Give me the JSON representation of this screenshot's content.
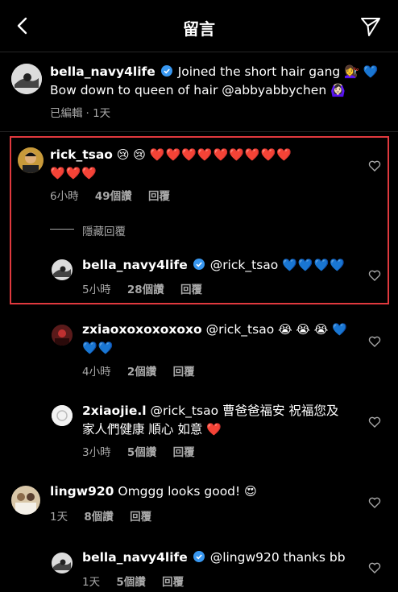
{
  "header": {
    "title": "留言"
  },
  "caption": {
    "username": "bella_navy4life",
    "text_line1": "Joined the short hair gang",
    "line1_emoji": "💇‍♀️",
    "line1_heart": "💙",
    "text_line2": "Bow down to queen of hair @abbyabbychen",
    "line2_emoji": "🙆🏻‍♀️",
    "edited": "已編輯",
    "time": "1天"
  },
  "comments": [
    {
      "username": "rick_tsao",
      "emoji_prefix": "😢 😢",
      "hearts_line1": "❤️❤️❤️❤️❤️❤️❤️❤️❤️",
      "hearts_line2": "❤️❤️❤️",
      "time": "6小時",
      "likes": "49個讚",
      "reply": "回覆",
      "hide_replies": "隱藏回覆",
      "replies": [
        {
          "username": "bella_navy4life",
          "mention": "@rick_tsao",
          "hearts": "💙💙💙💙",
          "time": "5小時",
          "likes": "28個讚",
          "reply": "回覆"
        },
        {
          "username": "zxiaoxoxoxoxoxo",
          "mention": "@rick_tsao",
          "emojis": "😭 😭 😭",
          "hearts_line1": "💙",
          "hearts_line2": "💙💙",
          "time": "4小時",
          "likes": "2個讚",
          "reply": "回覆"
        },
        {
          "username": "2xiaojie.l",
          "mention": "@rick_tsao",
          "text_line1": "曹爸爸福安 祝福您及",
          "text_line2": "家人們健康 順心 如意",
          "heart": "❤️",
          "time": "3小時",
          "likes": "5個讚",
          "reply": "回覆"
        }
      ]
    },
    {
      "username": "lingw920",
      "text": "Omggg looks good!",
      "emoji": "😍",
      "time": "1天",
      "likes": "8個讚",
      "reply": "回覆",
      "replies": [
        {
          "username": "bella_navy4life",
          "mention": "@lingw920",
          "text": "thanks bb",
          "time": "1天",
          "likes": "5個讚",
          "reply": "回覆"
        }
      ]
    }
  ],
  "colors": {
    "background": "#000000",
    "meta": "#a8a8a8",
    "highlight": "#e0393e",
    "verified": "#3897f0"
  }
}
